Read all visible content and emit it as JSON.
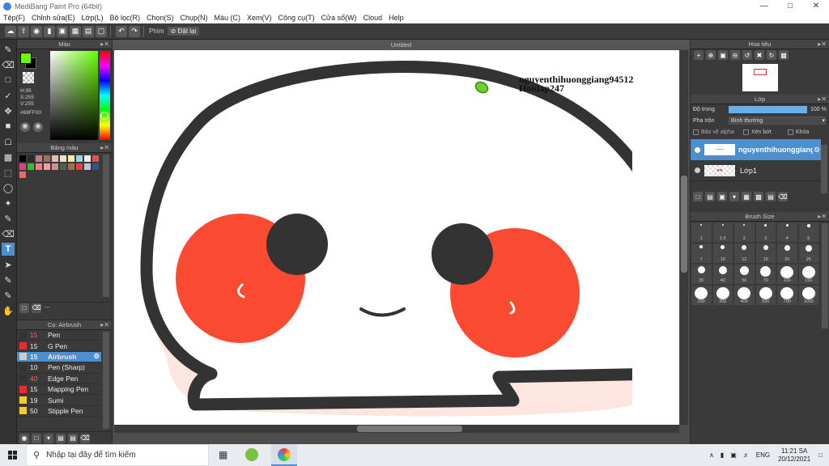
{
  "window": {
    "title": "MediBang Paint Pro (64bit)"
  },
  "menu": [
    "Tệp(F)",
    "Chỉnh sửa(E)",
    "Lớp(L)",
    "Bộ lọc(R)",
    "Chọn(S)",
    "Chụp(N)",
    "Màu (C)",
    "Xem(V)",
    "Công cụ(T)",
    "Cửa sổ(W)",
    "Cloud",
    "Help"
  ],
  "toolbar": {
    "phim_label": "Phím",
    "reset_label": "Đặt lại"
  },
  "color_panel": {
    "title": "Màu",
    "h": "H:95",
    "s": "S:255",
    "v": "V:255",
    "hex": "#68FF00",
    "primary_color": "#68ff00"
  },
  "palette_panel": {
    "title": "Bảng màu",
    "footer": "---"
  },
  "brush_panel": {
    "title": "Cọ: Airbrush",
    "items": [
      {
        "size": "15",
        "name": "Pen",
        "color": "#333333",
        "red": true
      },
      {
        "size": "15",
        "name": "G Pen",
        "color": "#e03030",
        "red": false
      },
      {
        "size": "15",
        "name": "Airbrush",
        "color": "#cccccc",
        "red": false,
        "selected": true
      },
      {
        "size": "10",
        "name": "Pen (Sharp)",
        "color": "#333333",
        "red": false
      },
      {
        "size": "40",
        "name": "Edge Pen",
        "color": "#333333",
        "red": true
      },
      {
        "size": "15",
        "name": "Mapping Pen",
        "color": "#e03030",
        "red": false
      },
      {
        "size": "19",
        "name": "Sumi",
        "color": "#f0d020",
        "red": false
      },
      {
        "size": "50",
        "name": "Stipple Pen",
        "color": "#f0d020",
        "red": false
      }
    ]
  },
  "canvas": {
    "tab": "Untitled",
    "watermark_line1": "nguyenthihuonggiang94512",
    "watermark_line2": "Hoidap247"
  },
  "navigator": {
    "title": "Hoa tiêu"
  },
  "layer_panel": {
    "title": "Lớp",
    "opacity_label": "Độ trong",
    "opacity_value": "100 %",
    "opacity_fraction": 1.0,
    "blend_label": "Pha trộn",
    "blend_value": "Bình thường",
    "protect_alpha": "Bảo vệ alpha",
    "clip": "Xén bớt",
    "lock": "Khóa",
    "layers": [
      {
        "name": "nguyenthihuonggiang",
        "selected": true
      },
      {
        "name": "Lớp1",
        "selected": false
      }
    ]
  },
  "brush_size": {
    "title": "Brush Size",
    "sizes": [
      "1",
      "1.5",
      "2",
      "3",
      "4",
      "5",
      "7",
      "10",
      "12",
      "15",
      "20",
      "25",
      "30",
      "40",
      "50",
      "70",
      "100",
      "150",
      "200",
      "300",
      "400",
      "500",
      "700",
      "1000"
    ]
  },
  "taskbar": {
    "search_placeholder": "Nhập tại đây để tìm kiếm",
    "lang": "ENG",
    "time": "11:21 SA",
    "date": "20/12/2021"
  }
}
